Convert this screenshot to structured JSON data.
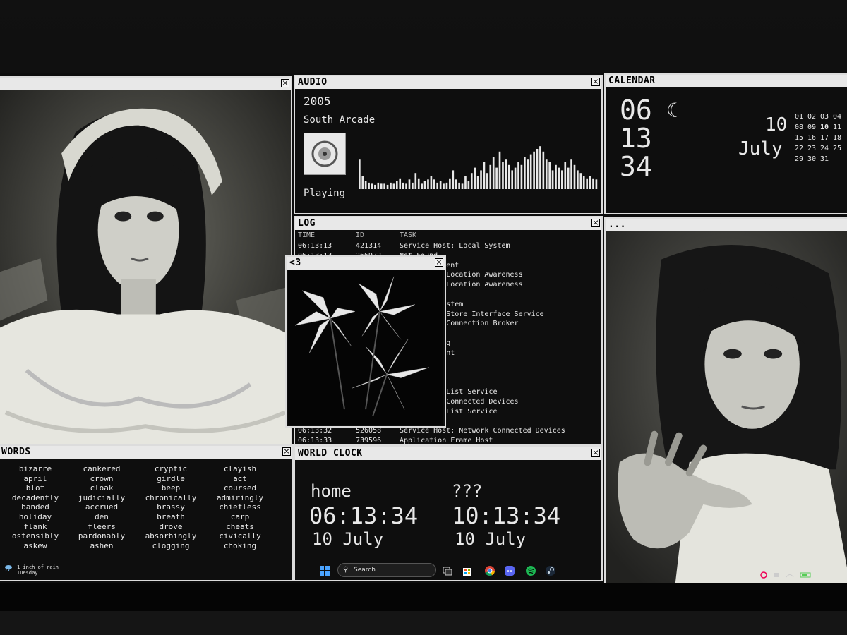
{
  "panels": {
    "audio_title": "AUDIO",
    "calendar_title": "CALENDAR",
    "log_title": "LOG",
    "image_title": "...",
    "popup_title": "<3",
    "words_title": "WORDS",
    "worldclock_title": "WORLD CLOCK"
  },
  "audio": {
    "track": "2005",
    "artist": "South Arcade",
    "status": "Playing",
    "levels": [
      0.55,
      0.25,
      0.15,
      0.12,
      0.1,
      0.08,
      0.12,
      0.1,
      0.1,
      0.08,
      0.12,
      0.1,
      0.15,
      0.2,
      0.12,
      0.1,
      0.18,
      0.12,
      0.3,
      0.2,
      0.1,
      0.15,
      0.18,
      0.25,
      0.18,
      0.12,
      0.15,
      0.1,
      0.12,
      0.2,
      0.35,
      0.18,
      0.12,
      0.1,
      0.25,
      0.15,
      0.3,
      0.4,
      0.25,
      0.35,
      0.5,
      0.3,
      0.45,
      0.6,
      0.4,
      0.7,
      0.5,
      0.55,
      0.45,
      0.35,
      0.4,
      0.5,
      0.45,
      0.6,
      0.55,
      0.65,
      0.7,
      0.75,
      0.8,
      0.7,
      0.55,
      0.5,
      0.35,
      0.45,
      0.4,
      0.35,
      0.5,
      0.4,
      0.55,
      0.45,
      0.35,
      0.3,
      0.25,
      0.2,
      0.25,
      0.2,
      0.18
    ]
  },
  "calendar": {
    "hour": "06",
    "minute": "13",
    "second": "34",
    "moon_icon": "moon-icon",
    "day": "10",
    "month": "July",
    "days": [
      "01",
      "02",
      "03",
      "04",
      "08",
      "09",
      "10",
      "11",
      "15",
      "16",
      "17",
      "18",
      "22",
      "23",
      "24",
      "25",
      "29",
      "30",
      "31"
    ],
    "today": "10"
  },
  "log": {
    "headers": {
      "time": "TIME",
      "id": "ID",
      "task": "TASK"
    },
    "rows": [
      {
        "time": "06:13:13",
        "id": "421314",
        "task": "Service Host: Local System"
      },
      {
        "time": "06:13:13",
        "id": "266972",
        "task": "Not Found"
      },
      {
        "time": "",
        "id": "",
        "task": "t: DHCP Client"
      },
      {
        "time": "",
        "id": "",
        "task": "t: Network Location Awareness"
      },
      {
        "time": "",
        "id": "",
        "task": "t: Network Location Awareness"
      },
      {
        "time": "",
        "id": "",
        "task": "ker"
      },
      {
        "time": "",
        "id": "",
        "task": "t: Local System"
      },
      {
        "time": "",
        "id": "",
        "task": "t: Network Store Interface Service"
      },
      {
        "time": "",
        "id": "",
        "task": "t: Network Connection Broker"
      },
      {
        "time": "",
        "id": "",
        "task": "rrupts"
      },
      {
        "time": "",
        "id": "",
        "task": "t: Event Log"
      },
      {
        "time": "",
        "id": "",
        "task": "t: DNS Client"
      },
      {
        "time": "",
        "id": "",
        "task": ""
      },
      {
        "time": "",
        "id": "",
        "task": "ager"
      },
      {
        "time": "",
        "id": "",
        "task": ""
      },
      {
        "time": "",
        "id": "",
        "task": "t: Network List Service"
      },
      {
        "time": "",
        "id": "",
        "task": "t: Network Connected Devices"
      },
      {
        "time": "",
        "id": "",
        "task": "t: Network List Service"
      },
      {
        "time": "",
        "id": "",
        "task": ""
      },
      {
        "time": "06:13:32",
        "id": "526058",
        "task": "Service Host: Network Connected Devices"
      },
      {
        "time": "06:13:33",
        "id": "739596",
        "task": "Application Frame Host"
      }
    ]
  },
  "words": {
    "col1": [
      "bizarre",
      "april",
      "blot",
      "decadently",
      "banded",
      "holiday",
      "flank",
      "ostensibly",
      "askew"
    ],
    "col2": [
      "cankered",
      "crown",
      "cloak",
      "judicially",
      "accrued",
      "den",
      "fleers",
      "pardonably",
      "ashen"
    ],
    "col3": [
      "cryptic",
      "girdle",
      "beep",
      "chronically",
      "brassy",
      "breath",
      "drove",
      "absorbingly",
      "clogging"
    ],
    "col4": [
      "clayish",
      "act",
      "coursed",
      "admiringly",
      "chiefless",
      "carp",
      "cheats",
      "civically",
      "choking"
    ]
  },
  "weather": {
    "line1": "1 inch of rain",
    "line2": "Tuesday",
    "icon": "rain-cloud-icon"
  },
  "worldclock": {
    "home_label": "home",
    "home_time": "06:13:34",
    "home_date": "10 July",
    "other_label": "???",
    "other_time": "10:13:34",
    "other_date": "10 July"
  },
  "taskbar": {
    "search_placeholder": "Search",
    "icons": [
      "windows-start-icon",
      "task-view-icon",
      "store-icon",
      "chrome-icon",
      "discord-icon",
      "spotify-icon",
      "steam-icon"
    ]
  }
}
